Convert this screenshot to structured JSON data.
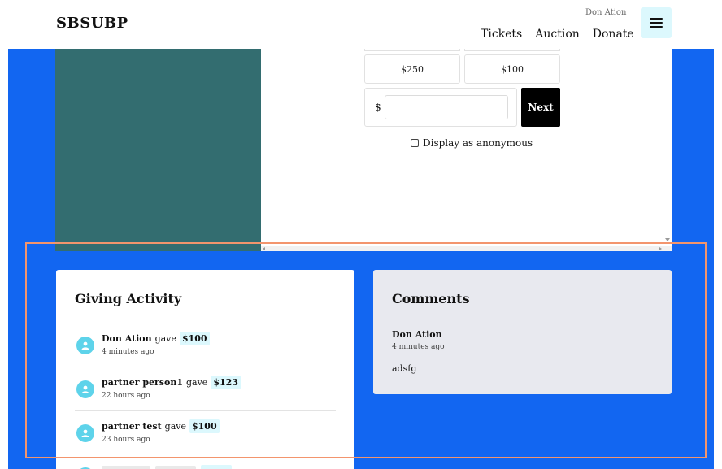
{
  "header": {
    "brand": "SBSUBP",
    "user_name": "Don Ation",
    "nav": [
      "Tickets",
      "Auction",
      "Donate"
    ],
    "menu_icon": "hamburger-icon"
  },
  "donation": {
    "amounts": [
      "$250",
      "$100"
    ],
    "currency_symbol": "$",
    "custom_value": "",
    "next_label": "Next",
    "anonymous_label": "Display as anonymous"
  },
  "activity": {
    "title": "Giving Activity",
    "items": [
      {
        "name": "Don Ation",
        "verb": "gave",
        "amount": "$100",
        "time": "4 minutes ago"
      },
      {
        "name": "partner person1",
        "verb": "gave",
        "amount": "$123",
        "time": "22 hours ago"
      },
      {
        "name": "partner test",
        "verb": "gave",
        "amount": "$100",
        "time": "23 hours ago"
      }
    ]
  },
  "comments": {
    "title": "Comments",
    "items": [
      {
        "author": "Don Ation",
        "time": "4 minutes ago",
        "text": "adsfg"
      }
    ]
  },
  "colors": {
    "blue_bg": "#1266f1",
    "teal_panel": "#336d70",
    "accent_cyan": "#dcf8fd",
    "avatar": "#5ed3ea",
    "highlight": "#f3956d"
  }
}
